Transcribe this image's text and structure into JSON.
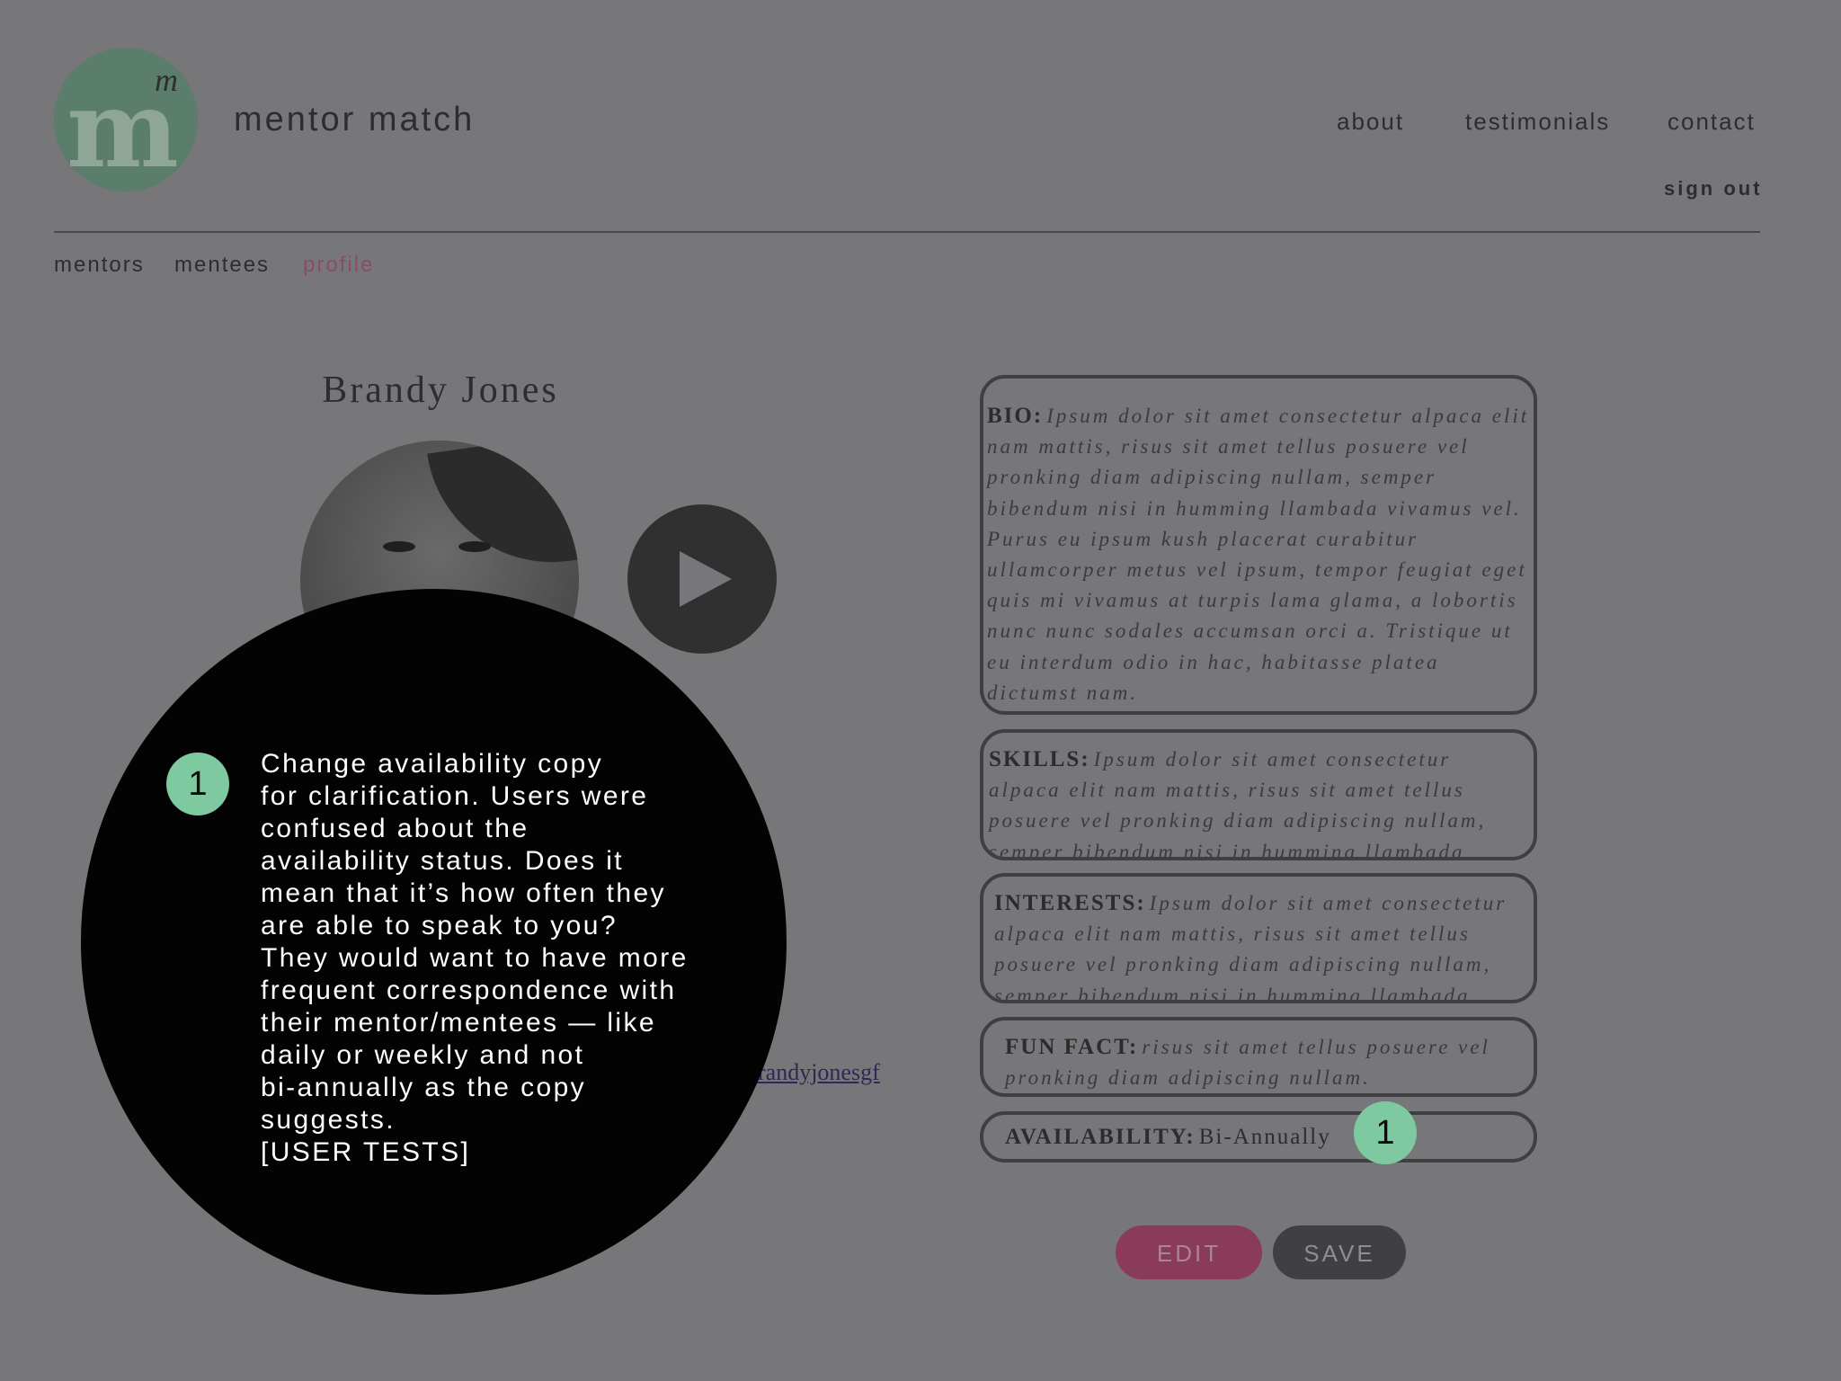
{
  "header": {
    "logo_letter": "m",
    "logo_small_letter": "m",
    "brand_name": "mentor match",
    "nav": [
      "about",
      "testimonials",
      "contact"
    ],
    "sign_out": "sign out",
    "logo_color": "#5b7e6c"
  },
  "subnav": {
    "items": [
      "mentors",
      "mentees",
      "profile"
    ],
    "active": "profile",
    "active_color": "#8a4d64"
  },
  "profile": {
    "name": "Brandy Jones",
    "link_text": "brandyjonesgf"
  },
  "boxes": {
    "bio": {
      "label": "BIO:",
      "text": "Ipsum dolor sit amet consectetur alpaca elit nam mattis, risus sit amet tellus posuere vel pronking diam adipiscing nullam, semper bibendum nisi in humming llambada vivamus vel. Purus eu ipsum kush placerat curabitur ullamcorper metus vel ipsum, tempor feugiat eget quis mi vivamus at turpis lama glama, a lobortis nunc nunc sodales accumsan orci a. Tristique ut eu interdum odio in hac, habitasse platea dictumst nam."
    },
    "skills": {
      "label": "SKILLS:",
      "text": "Ipsum dolor sit amet consectetur alpaca elit nam mattis, risus sit amet tellus posuere vel pronking diam adipiscing nullam, semper bibendum nisi in humming llambada vivamus."
    },
    "interests": {
      "label": "INTERESTS:",
      "text": "Ipsum dolor sit amet consectetur alpaca elit nam mattis, risus sit amet tellus posuere vel pronking diam adipiscing nullam, semper bibendum nisi in humming llambada."
    },
    "fun_fact": {
      "label": "FUN FACT:",
      "text": "risus sit amet tellus posuere vel pronking diam adipiscing nullam."
    },
    "availability": {
      "label": "AVAILABILITY:",
      "value": "Bi-Annually"
    }
  },
  "buttons": {
    "edit": "EDIT",
    "save": "SAVE",
    "edit_color": "#8a3b58"
  },
  "annotation": {
    "marker": "1",
    "marker_color": "#7ec9a0",
    "text": "Change availability copy\nfor clarification. Users were\nconfused about the\navailability status. Does it\nmean that it’s how often they\nare able to speak to you?\nThey would want to have more\nfrequent correspondence with\ntheir mentor/mentees — like\ndaily or weekly and not\nbi-annually as the copy\nsuggests.\n[USER TESTS]"
  }
}
